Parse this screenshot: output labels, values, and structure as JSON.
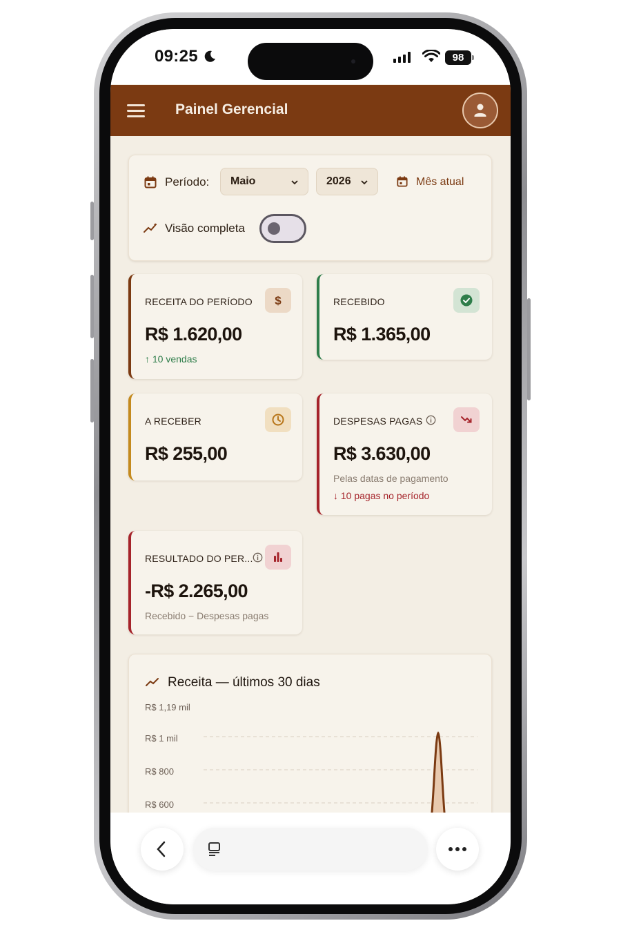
{
  "status_bar": {
    "time": "09:25",
    "battery": "98"
  },
  "header": {
    "title": "Painel Gerencial"
  },
  "filters": {
    "period_label": "Período:",
    "month": "Maio",
    "year": "2026",
    "current_month_button": "Mês atual",
    "full_view_label": "Visão completa",
    "full_view_enabled": false
  },
  "stats": [
    {
      "label": "RECEITA DO PERÍODO",
      "value": "R$ 1.620,00",
      "note": "↑ 10 vendas",
      "accent": "#7b3a12",
      "icon": "dollar-icon"
    },
    {
      "label": "RECEBIDO",
      "value": "R$ 1.365,00",
      "accent": "#2e7d4a",
      "icon": "check-circle-icon"
    },
    {
      "label": "A RECEBER",
      "value": "R$ 255,00",
      "accent": "#c48a1e",
      "icon": "clock-icon"
    },
    {
      "label": "DESPESAS PAGAS",
      "value": "R$ 3.630,00",
      "sub": "Pelas datas de pagamento",
      "note": "↓ 10 pagas no período",
      "accent": "#a5232a",
      "icon": "trending-down-icon"
    },
    {
      "label": "RESULTADO DO PER...",
      "value": "-R$ 2.265,00",
      "sub": "Recebido − Despesas pagas",
      "accent": "#a5232a",
      "icon": "bar-chart-icon"
    }
  ],
  "colors": {
    "brand": "#7b3a12",
    "positive": "#2e7d4a",
    "warning": "#c48a1e",
    "negative": "#a5232a"
  },
  "chart": {
    "title": "Receita — últimos 30 dias",
    "y_tick_labels": [
      "R$ 1,19 mil",
      "R$ 1 mil",
      "R$ 800",
      "R$ 600"
    ]
  },
  "chart_data": {
    "type": "area",
    "title": "Receita — últimos 30 dias",
    "y_ticks": [
      1190,
      1000,
      800,
      600
    ],
    "y_visible_range": [
      600,
      1190
    ],
    "peak_value": 1000,
    "grid": true
  }
}
